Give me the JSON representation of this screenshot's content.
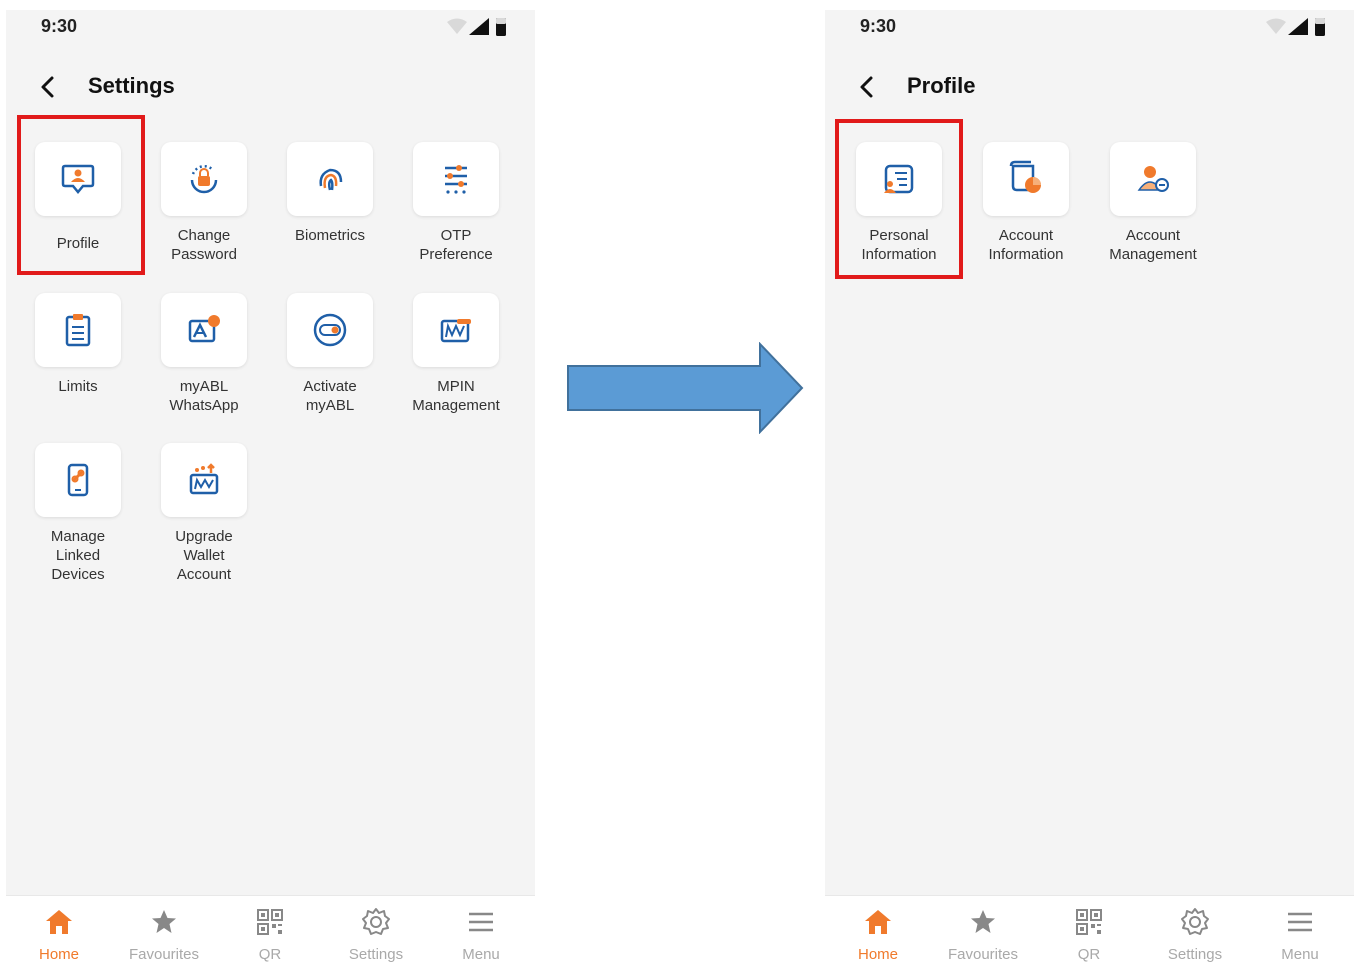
{
  "left_screen": {
    "status_time": "9:30",
    "title": "Settings",
    "tiles": [
      {
        "label": "Profile",
        "icon": "profile-badge-icon"
      },
      {
        "label": "Change\nPassword",
        "icon": "lock-rotate-icon"
      },
      {
        "label": "Biometrics",
        "icon": "fingerprint-icon"
      },
      {
        "label": "OTP\nPreference",
        "icon": "sliders-icon"
      },
      {
        "label": "Limits",
        "icon": "clipboard-icon"
      },
      {
        "label": "myABL\nWhatsApp",
        "icon": "whatsapp-card-icon"
      },
      {
        "label": "Activate\nmyABL",
        "icon": "toggle-icon"
      },
      {
        "label": "MPIN\nManagement",
        "icon": "mpin-card-icon"
      },
      {
        "label": "Manage\nLinked\nDevices",
        "icon": "linked-device-icon"
      },
      {
        "label": "Upgrade\nWallet\nAccount",
        "icon": "wallet-upgrade-icon"
      }
    ]
  },
  "right_screen": {
    "status_time": "9:30",
    "title": "Profile",
    "tiles": [
      {
        "label": "Personal\nInformation",
        "icon": "id-card-icon"
      },
      {
        "label": "Account\nInformation",
        "icon": "account-pie-icon"
      },
      {
        "label": "Account\nManagement",
        "icon": "user-manage-icon"
      }
    ]
  },
  "bottom_nav": [
    {
      "label": "Home",
      "icon": "home-icon",
      "active": true
    },
    {
      "label": "Favourites",
      "icon": "star-icon",
      "active": false
    },
    {
      "label": "QR",
      "icon": "qr-icon",
      "active": false
    },
    {
      "label": "Settings",
      "icon": "gear-icon",
      "active": false
    },
    {
      "label": "Menu",
      "icon": "hamburger-icon",
      "active": false
    }
  ],
  "colors": {
    "accent_orange": "#f07a2c",
    "icon_blue": "#1f5fa8",
    "highlight_red": "#e11a1a",
    "arrow_blue": "#5b9bd5",
    "arrow_outline": "#41719c",
    "screen_bg": "#f4f4f4"
  }
}
